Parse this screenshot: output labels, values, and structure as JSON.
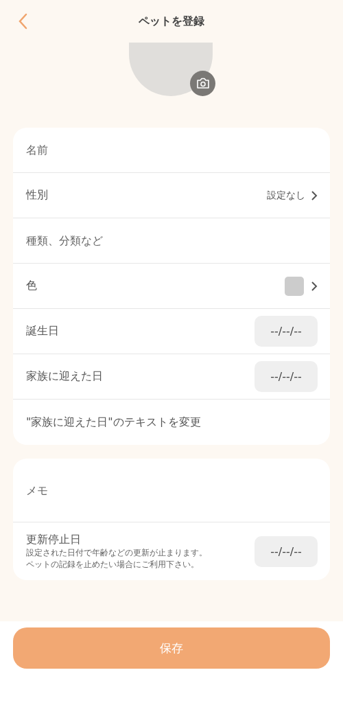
{
  "header": {
    "title": "ペットを登録"
  },
  "profile_card": {
    "rows": [
      {
        "kind": "text",
        "placeholder": "名前"
      },
      {
        "kind": "select",
        "label": "性別",
        "value": "設定なし"
      },
      {
        "kind": "text",
        "placeholder": "種類、分類など"
      },
      {
        "kind": "color",
        "label": "色",
        "color": "#cccccc"
      },
      {
        "kind": "date",
        "label": "誕生日",
        "value": "--/--/--"
      },
      {
        "kind": "date",
        "label": "家族に迎えた日",
        "value": "--/--/--"
      },
      {
        "kind": "link",
        "label": "\"家族に迎えた日\"のテキストを変更"
      }
    ]
  },
  "memo_card": {
    "memo": {
      "placeholder": "メモ"
    },
    "stop_date": {
      "label": "更新停止日",
      "description": [
        "設定された日付で年齢などの更新が止まります。",
        "ペットの記録を止めたい場合にご利用下さい。"
      ],
      "value": "--/--/--"
    }
  },
  "save_button": {
    "label": "保存"
  }
}
